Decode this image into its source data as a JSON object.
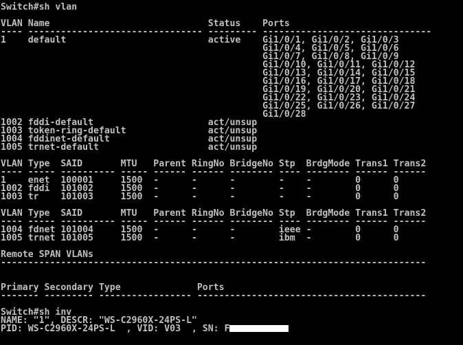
{
  "terminal": {
    "lines": [
      "Switch#sh vlan",
      "",
      "VLAN Name                             Status    Ports",
      "---- -------------------------------- --------- -------------------------------",
      "1    default                          active    Gi1/0/1, Gi1/0/2, Gi1/0/3",
      "                                                Gi1/0/4, Gi1/0/5, Gi1/0/6",
      "                                                Gi1/0/7, Gi1/0/8, Gi1/0/9",
      "                                                Gi1/0/10, Gi1/0/11, Gi1/0/12",
      "                                                Gi1/0/13, Gi1/0/14, Gi1/0/15",
      "                                                Gi1/0/16, Gi1/0/17, Gi1/0/18",
      "                                                Gi1/0/19, Gi1/0/20, Gi1/0/21",
      "                                                Gi1/0/22, Gi1/0/23, Gi1/0/24",
      "                                                Gi1/0/25, Gi1/0/26, Gi1/0/27",
      "                                                Gi1/0/28",
      "1002 fddi-default                     act/unsup",
      "1003 token-ring-default               act/unsup",
      "1004 fddinet-default                  act/unsup",
      "1005 trnet-default                    act/unsup",
      "",
      "VLAN Type  SAID       MTU   Parent RingNo BridgeNo Stp  BrdgMode Trans1 Trans2",
      "---- ----- ---------- ----- ------ ------ -------- ---- -------- ------ ------",
      "1    enet  100001     1500  -      -      -        -    -        0      0",
      "1002 fddi  101002     1500  -      -      -        -    -        0      0",
      "1003 tr    101003     1500  -      -      -        -    -        0      0",
      "",
      "VLAN Type  SAID       MTU   Parent RingNo BridgeNo Stp  BrdgMode Trans1 Trans2",
      "---- ----- ---------- ----- ------ ------ -------- ---- -------- ------ ------",
      "1004 fdnet 101004     1500  -      -      -        ieee -        0      0",
      "1005 trnet 101005     1500  -      -      -        ibm  -        0      0",
      "",
      "Remote SPAN VLANs",
      "------------------------------------------------------------------------------",
      "",
      "",
      "Primary Secondary Type              Ports",
      "------- --------- ----------------- ------------------------------------------",
      "",
      "Switch#sh inv",
      "NAME: \"1\", DESCR: \"WS-C2960X-24PS-L\"",
      "PID: WS-C2960X-24PS-L  , VID: V03  , SN: F"
    ]
  }
}
